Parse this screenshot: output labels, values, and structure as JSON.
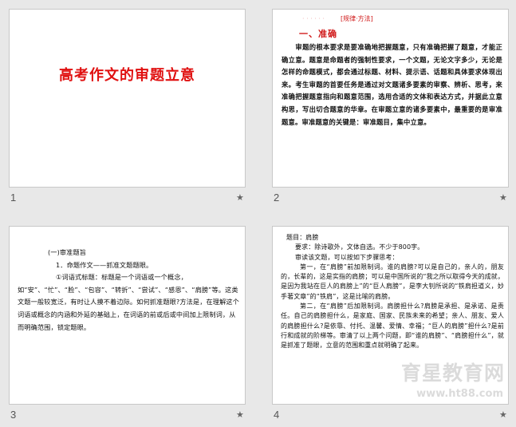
{
  "slides": [
    {
      "number": "1",
      "title": "高考作文的审题立意"
    },
    {
      "number": "2",
      "header_prefix": "· · · · · ·",
      "header_tag": "[规律·方法]",
      "subtitle": "一、准确",
      "body": "审题的根本要求是要准确地把握题意，只有准确把握了题意，才能正确立意。题意是命题者的强制性要求，一个文题，无论文字多少，无论是怎样的命题模式，都会通过标题、材料、提示语、话题和具体要求体现出来。考生审题的首要任务是通过对文题诸多要素的审察、辨析、思考，来准确把握题意指向和题意范围，选用合适的文体和表达方式，并据此立意构思，写出切合题意的华章。在审题立意的诸多要素中，最重要的是审准题意。审准题意的关键是：审准题目，集中立意。"
    },
    {
      "number": "3",
      "line1": "(一)审准题旨",
      "line2": "1．命题作文——抓准文题题眼。",
      "para1": "①词语式标题：标题是一个词语或一个概念，如“安”、“忙”、“脸”、“包容”、“转折”、“尝试”、“感恩”、“肩膀”等。这类文题一般较宽泛，有时让人摸不着边际。如何抓准题眼?方法是，在理解这个词语或概念的内涵和外延的基础上，在词语的前或后或中间加上限制词，从而明确范围，锁定题眼。"
    },
    {
      "number": "4",
      "line1": "题目：肩膀",
      "line2": "要求：除诗歌外，文体自选。不少于800字。",
      "line3": "审读该文题，可以按如下步骤思考：",
      "para1": "第一，在“肩膀”前加限制词。谁的肩膀?可以是自己的，亲人的，朋友的，长辈的，这是实指的肩膀；可以是中国所说的“我之所以取得今天的成就，是因为我站在巨人的肩膀上”的“巨人肩膀”，是李大钊所说的“铁肩担道义，妙手著文章”的“铁肩”，这是比喻的肩膀。",
      "para2": "第二，在“肩膀”后加限制词。肩膀担什么?肩膀是承担、是承诺、是责任。自己的肩膀担什么，是家庭、国家、民族未来的希望；亲人、朋友、爱人的肩膀担什么?是依靠、付托、温馨、爱情、幸福；“巨人的肩膀”担什么?是前行和成就的阶梯等。审清了以上两个问题，即“谁的肩膀”、“肩膀担什么”，就是抓准了题眼，立意的范围和重点就明确了起来。",
      "watermark": "育星教育网",
      "watermark_url": "www.ht88.com"
    }
  ],
  "star_glyph": "★"
}
